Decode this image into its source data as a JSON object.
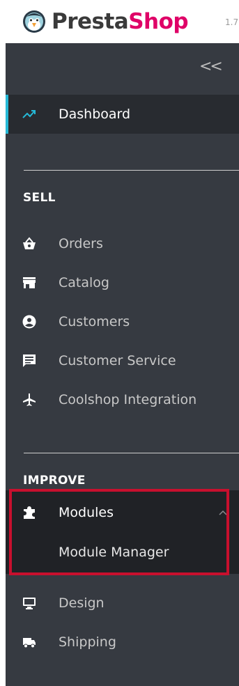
{
  "brand": {
    "name_part1": "Presta",
    "name_part2": "Shop",
    "version": "1.7"
  },
  "sidebar": {
    "collapse_label": "<<",
    "dashboard_label": "Dashboard",
    "sections": [
      {
        "title": "SELL",
        "items": [
          {
            "label": "Orders",
            "icon": "shopping-basket-icon"
          },
          {
            "label": "Catalog",
            "icon": "store-icon"
          },
          {
            "label": "Customers",
            "icon": "account-circle-icon"
          },
          {
            "label": "Customer Service",
            "icon": "chat-icon"
          },
          {
            "label": "Coolshop Integration",
            "icon": "airplane-icon"
          }
        ]
      },
      {
        "title": "IMPROVE",
        "items": [
          {
            "label": "Modules",
            "icon": "puzzle-icon",
            "expanded": true,
            "children": [
              {
                "label": "Module Manager"
              }
            ]
          },
          {
            "label": "Design",
            "icon": "desktop-icon"
          },
          {
            "label": "Shipping",
            "icon": "truck-icon"
          }
        ]
      }
    ]
  },
  "colors": {
    "sidebar_bg": "#363a41",
    "active_bg": "#282b30",
    "accent": "#25b9d7",
    "brand_pink": "#df0067",
    "highlight_red": "#c8102e"
  }
}
